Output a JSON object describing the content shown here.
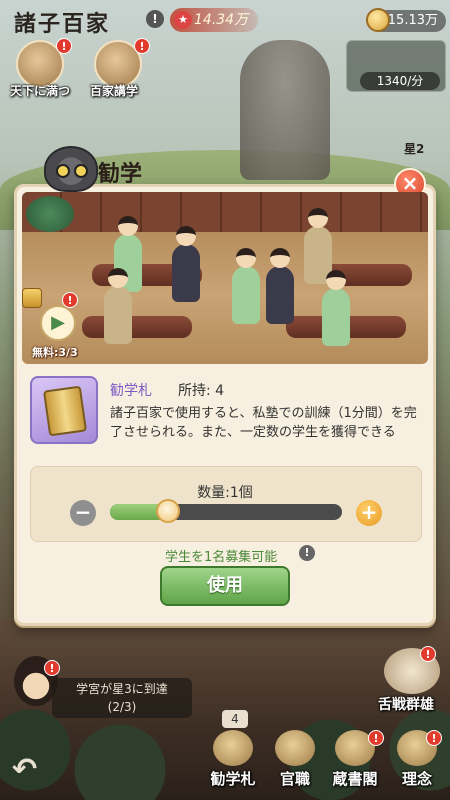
{
  "hud": {
    "game_title": "諸子百家",
    "fame_value": "14.34万",
    "currency_value": "15.13万",
    "rate_value": "1340/分",
    "star_label": "星2"
  },
  "events": [
    {
      "label": "天下に満つ",
      "badge": "!"
    },
    {
      "label": "百家講学",
      "badge": "!"
    }
  ],
  "modal": {
    "title": "勧学",
    "close_label": "×",
    "free_label": "無料:3/3",
    "item_name": "勧学札",
    "item_owned": "所持: 4",
    "item_description": "諸子百家で使用すると、私塾での訓練（1分間）を完了させられる。また、一定数の学生を獲得できる",
    "quantity_label": "数量:1個",
    "quantity_fraction": 0.25,
    "recruit_text": "学生を1名募集可能",
    "use_button": "使用"
  },
  "quest": {
    "line1": "学宮が星3に到達",
    "line2": "(2/3)"
  },
  "debate_label": "舌戦群雄",
  "bottom_bar": {
    "count": "4",
    "items": [
      {
        "label": "勧学札",
        "icon": "scroll-icon"
      },
      {
        "label": "官職",
        "icon": "rank-icon"
      },
      {
        "label": "蔵書閣",
        "icon": "library-icon"
      },
      {
        "label": "理念",
        "icon": "philosophy-icon"
      }
    ]
  },
  "colors": {
    "accent_green": "#5fa448",
    "item_purple": "#7b5bc4",
    "close_red": "#d9442c"
  }
}
